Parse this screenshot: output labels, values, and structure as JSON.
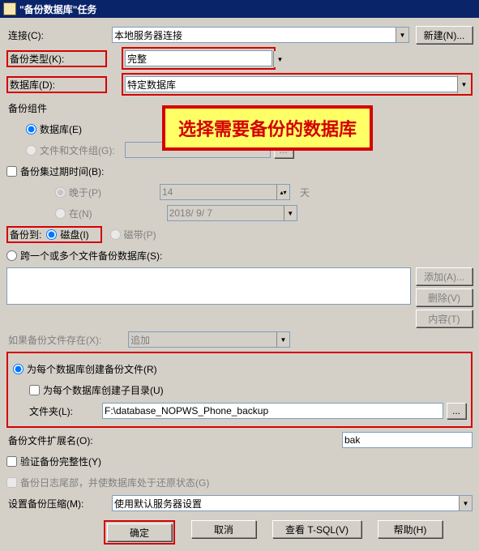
{
  "title": "\"备份数据库\"任务",
  "labels": {
    "connection": "连接(C):",
    "backupType": "备份类型(K):",
    "database": "数据库(D):",
    "backupComponent": "备份组件",
    "databaseRadio": "数据库(E)",
    "filesRadio": "文件和文件组(G):",
    "backupSetExpire": "备份集过期时间(B):",
    "laterThan": "晚于(P)",
    "at": "在(N)",
    "days": "天",
    "backupTo": "备份到:",
    "disk": "磁盘(I)",
    "tape": "磁带(P)",
    "span": "跨一个或多个文件备份数据库(S):",
    "ifExists": "如果备份文件存在(X):",
    "createPerDb": "为每个数据库创建备份文件(R)",
    "createSubdir": "为每个数据库创建子目录(U)",
    "folder": "文件夹(L):",
    "ext": "备份文件扩展名(O):",
    "verify": "验证备份完整性(Y)",
    "tailLog": "备份日志尾部，并使数据库处于还原状态(G)",
    "compression": "设置备份压缩(M):"
  },
  "values": {
    "connection": "本地服务器连接",
    "backupType": "完整",
    "database": "特定数据库",
    "expireDays": "14",
    "expireDate": "2018/ 9/ 7",
    "ifExists": "追加",
    "folder": "F:\\database_NOPWS_Phone_backup",
    "ext": "bak",
    "compression": "使用默认服务器设置"
  },
  "buttons": {
    "new": "新建(N)...",
    "add": "添加(A)...",
    "remove": "删除(V)",
    "contents": "内容(T)",
    "ok": "确定",
    "cancel": "取消",
    "viewTsql": "查看 T-SQL(V)",
    "help": "帮助(H)",
    "browse": "..."
  },
  "callout": "选择需要备份的数据库"
}
